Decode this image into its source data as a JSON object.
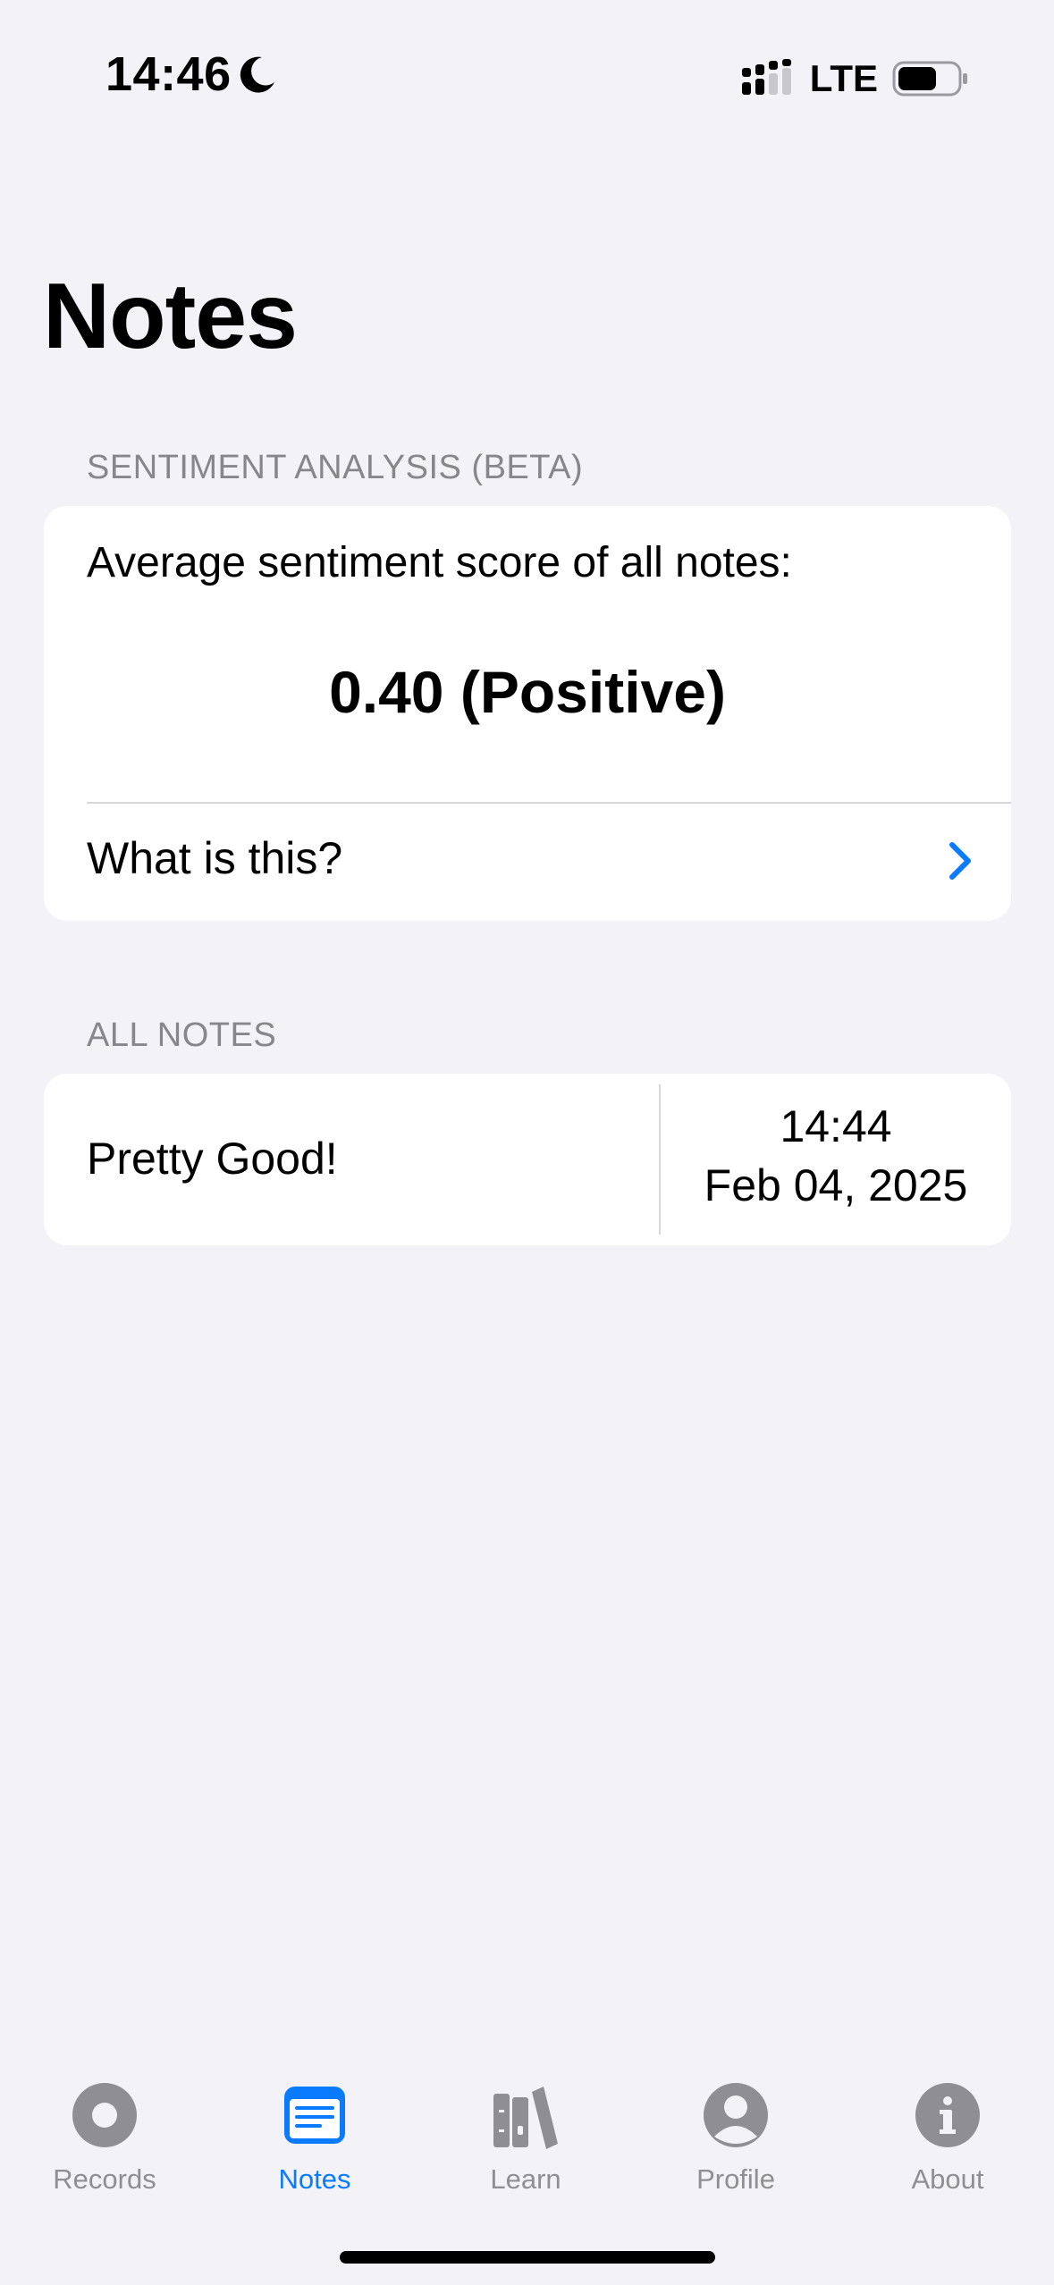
{
  "status_bar": {
    "time": "14:46",
    "network": "LTE"
  },
  "page": {
    "title": "Notes"
  },
  "sentiment": {
    "header": "SENTIMENT ANALYSIS (BETA)",
    "label": "Average sentiment score of all notes:",
    "score": "0.40 (Positive)",
    "help_label": "What is this?"
  },
  "notes": {
    "header": "ALL NOTES",
    "items": [
      {
        "title": "Pretty Good!",
        "time": "14:44",
        "date": "Feb 04, 2025"
      }
    ]
  },
  "tab_bar": {
    "tabs": [
      {
        "label": "Records",
        "icon": "record-circle-icon"
      },
      {
        "label": "Notes",
        "icon": "notes-list-icon"
      },
      {
        "label": "Learn",
        "icon": "books-icon"
      },
      {
        "label": "Profile",
        "icon": "person-circle-icon"
      },
      {
        "label": "About",
        "icon": "info-circle-icon"
      }
    ],
    "active_index": 1
  },
  "colors": {
    "accent": "#0a7aff",
    "inactive": "#8e8e93",
    "background": "#f2f2f7",
    "card": "#ffffff"
  }
}
